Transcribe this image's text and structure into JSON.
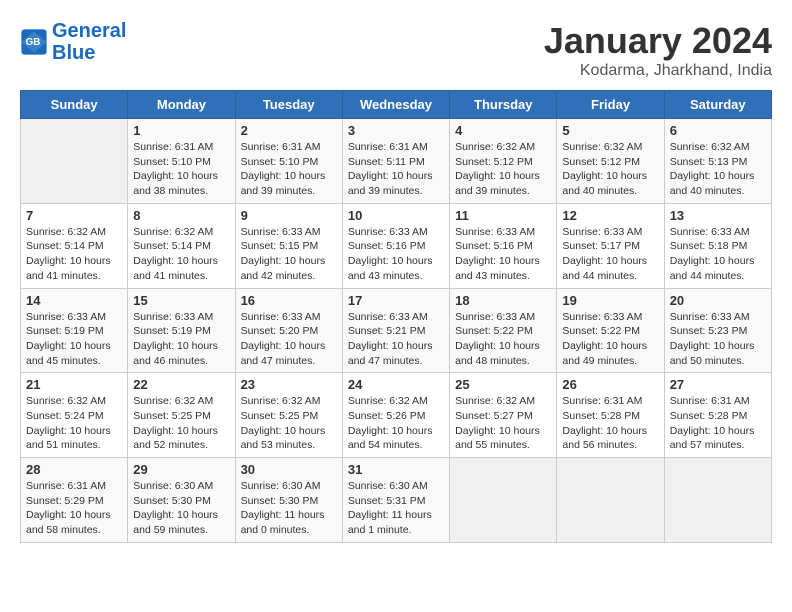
{
  "header": {
    "logo_line1": "General",
    "logo_line2": "Blue",
    "month": "January 2024",
    "location": "Kodarma, Jharkhand, India"
  },
  "weekdays": [
    "Sunday",
    "Monday",
    "Tuesday",
    "Wednesday",
    "Thursday",
    "Friday",
    "Saturday"
  ],
  "weeks": [
    [
      {
        "day": "",
        "info": ""
      },
      {
        "day": "1",
        "info": "Sunrise: 6:31 AM\nSunset: 5:10 PM\nDaylight: 10 hours\nand 38 minutes."
      },
      {
        "day": "2",
        "info": "Sunrise: 6:31 AM\nSunset: 5:10 PM\nDaylight: 10 hours\nand 39 minutes."
      },
      {
        "day": "3",
        "info": "Sunrise: 6:31 AM\nSunset: 5:11 PM\nDaylight: 10 hours\nand 39 minutes."
      },
      {
        "day": "4",
        "info": "Sunrise: 6:32 AM\nSunset: 5:12 PM\nDaylight: 10 hours\nand 39 minutes."
      },
      {
        "day": "5",
        "info": "Sunrise: 6:32 AM\nSunset: 5:12 PM\nDaylight: 10 hours\nand 40 minutes."
      },
      {
        "day": "6",
        "info": "Sunrise: 6:32 AM\nSunset: 5:13 PM\nDaylight: 10 hours\nand 40 minutes."
      }
    ],
    [
      {
        "day": "7",
        "info": "Sunrise: 6:32 AM\nSunset: 5:14 PM\nDaylight: 10 hours\nand 41 minutes."
      },
      {
        "day": "8",
        "info": "Sunrise: 6:32 AM\nSunset: 5:14 PM\nDaylight: 10 hours\nand 41 minutes."
      },
      {
        "day": "9",
        "info": "Sunrise: 6:33 AM\nSunset: 5:15 PM\nDaylight: 10 hours\nand 42 minutes."
      },
      {
        "day": "10",
        "info": "Sunrise: 6:33 AM\nSunset: 5:16 PM\nDaylight: 10 hours\nand 43 minutes."
      },
      {
        "day": "11",
        "info": "Sunrise: 6:33 AM\nSunset: 5:16 PM\nDaylight: 10 hours\nand 43 minutes."
      },
      {
        "day": "12",
        "info": "Sunrise: 6:33 AM\nSunset: 5:17 PM\nDaylight: 10 hours\nand 44 minutes."
      },
      {
        "day": "13",
        "info": "Sunrise: 6:33 AM\nSunset: 5:18 PM\nDaylight: 10 hours\nand 44 minutes."
      }
    ],
    [
      {
        "day": "14",
        "info": "Sunrise: 6:33 AM\nSunset: 5:19 PM\nDaylight: 10 hours\nand 45 minutes."
      },
      {
        "day": "15",
        "info": "Sunrise: 6:33 AM\nSunset: 5:19 PM\nDaylight: 10 hours\nand 46 minutes."
      },
      {
        "day": "16",
        "info": "Sunrise: 6:33 AM\nSunset: 5:20 PM\nDaylight: 10 hours\nand 47 minutes."
      },
      {
        "day": "17",
        "info": "Sunrise: 6:33 AM\nSunset: 5:21 PM\nDaylight: 10 hours\nand 47 minutes."
      },
      {
        "day": "18",
        "info": "Sunrise: 6:33 AM\nSunset: 5:22 PM\nDaylight: 10 hours\nand 48 minutes."
      },
      {
        "day": "19",
        "info": "Sunrise: 6:33 AM\nSunset: 5:22 PM\nDaylight: 10 hours\nand 49 minutes."
      },
      {
        "day": "20",
        "info": "Sunrise: 6:33 AM\nSunset: 5:23 PM\nDaylight: 10 hours\nand 50 minutes."
      }
    ],
    [
      {
        "day": "21",
        "info": "Sunrise: 6:32 AM\nSunset: 5:24 PM\nDaylight: 10 hours\nand 51 minutes."
      },
      {
        "day": "22",
        "info": "Sunrise: 6:32 AM\nSunset: 5:25 PM\nDaylight: 10 hours\nand 52 minutes."
      },
      {
        "day": "23",
        "info": "Sunrise: 6:32 AM\nSunset: 5:25 PM\nDaylight: 10 hours\nand 53 minutes."
      },
      {
        "day": "24",
        "info": "Sunrise: 6:32 AM\nSunset: 5:26 PM\nDaylight: 10 hours\nand 54 minutes."
      },
      {
        "day": "25",
        "info": "Sunrise: 6:32 AM\nSunset: 5:27 PM\nDaylight: 10 hours\nand 55 minutes."
      },
      {
        "day": "26",
        "info": "Sunrise: 6:31 AM\nSunset: 5:28 PM\nDaylight: 10 hours\nand 56 minutes."
      },
      {
        "day": "27",
        "info": "Sunrise: 6:31 AM\nSunset: 5:28 PM\nDaylight: 10 hours\nand 57 minutes."
      }
    ],
    [
      {
        "day": "28",
        "info": "Sunrise: 6:31 AM\nSunset: 5:29 PM\nDaylight: 10 hours\nand 58 minutes."
      },
      {
        "day": "29",
        "info": "Sunrise: 6:30 AM\nSunset: 5:30 PM\nDaylight: 10 hours\nand 59 minutes."
      },
      {
        "day": "30",
        "info": "Sunrise: 6:30 AM\nSunset: 5:30 PM\nDaylight: 11 hours\nand 0 minutes."
      },
      {
        "day": "31",
        "info": "Sunrise: 6:30 AM\nSunset: 5:31 PM\nDaylight: 11 hours\nand 1 minute."
      },
      {
        "day": "",
        "info": ""
      },
      {
        "day": "",
        "info": ""
      },
      {
        "day": "",
        "info": ""
      }
    ]
  ]
}
